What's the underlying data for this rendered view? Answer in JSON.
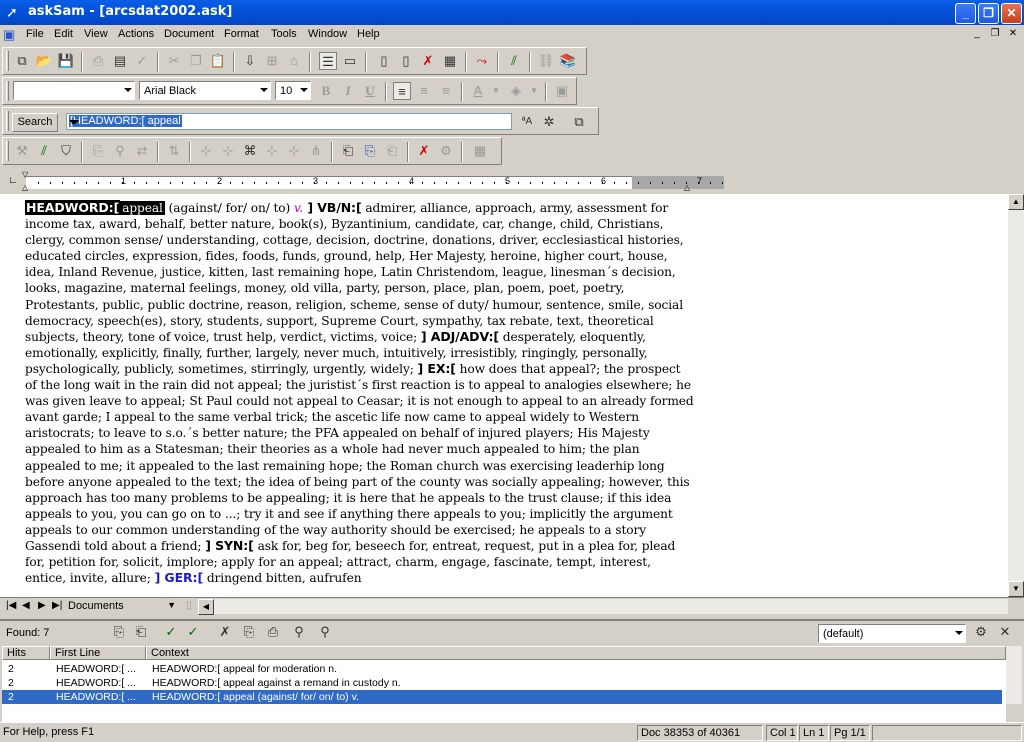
{
  "window": {
    "title": "askSam - [arcsdat2002.ask]",
    "minimize": "_",
    "restore": "❐",
    "close": "✕"
  },
  "menu": {
    "items": [
      "File",
      "Edit",
      "View",
      "Actions",
      "Document",
      "Format",
      "Tools",
      "Window",
      "Help"
    ],
    "mdi_min": "_",
    "mdi_restore": "❐",
    "mdi_close": "✕"
  },
  "format_bar": {
    "style_value": "",
    "font_value": "Arial Black",
    "size_value": "10",
    "bold": "B",
    "italic": "I",
    "underline": "U"
  },
  "search_bar": {
    "button_label": "Search",
    "query": "[HEADWORD:[ appeal"
  },
  "ruler": {
    "marks": [
      "1",
      "2",
      "3",
      "4",
      "5",
      "6",
      "7"
    ]
  },
  "document": {
    "headword_tag": "HEADWORD:[",
    "headword": "appeal",
    "senses": " (against/ for/ on/ to) ",
    "pos": "v.",
    "vbn_tag": " ] VB/N:[",
    "vbn_text": " admirer, alliance, approach, army, assessment for income tax, award, behalf, better nature, book(s), Byzantinium, candidate, car, change, child, Christians, clergy, common sense/ understanding, cottage, decision, doctrine, donations, driver, ecclesiastical histories, educated circles, expression, fides, foods, funds, ground, help, Her Majesty, heroine, higher court, house, idea, Inland Revenue, justice, kitten, last remaining hope, Latin Christendom, league, linesman´s decision, looks, magazine, maternal feelings, money, old villa, party, person, place, plan, poem, poet, poetry, Protestants, public, public doctrine, reason, religion, scheme, sense of duty/ humour, sentence, smile, social democracy, speech(es), story, students, support, Supreme Court, sympathy, tax rebate, text, theoretical subjects, theory, tone of voice, trust help, verdict, victims, voice;  ",
    "adjadv_tag": "] ADJ/ADV:[",
    "adjadv_text": " desperately, eloquently, emotionally, explicitly, finally, further, largely, never much, intuitively, irresistibly, ringingly, personally, psychologically, publicly, sometimes, stirringly, urgently, widely;  ",
    "ex_tag": "] EX:[",
    "ex_text": " how does that appeal?; the prospect of the long wait in the rain did not appeal; the juristist´s first reaction is to appeal to analogies elsewhere; he was given leave to appeal; St Paul could not appeal to Ceasar; it is not enough to appeal to an already formed avant garde; I appeal to the same verbal trick; the ascetic life now came to appeal widely to Western aristocrats; to leave to s.o.´s better nature; the PFA appealed on behalf of injured players; His Majesty appealed to him as a Statesman; their theories as a whole had never much appealed to him; the plan appealed to me; it appealed to the last remaining hope; the Roman church was exercising leaderhip long before anyone appealed to the text; the idea of being part of the county was socially appealing; however, this approach has too many problems to be appealing; it is here that he appeals to the trust clause; if this idea appeals to you, you can go on to ...; try it and see if anything there appeals to you; implicitly the argument appeals to our common understanding of the way authority should be exercised; he appeals to a story Gassendi told about a friend;  ",
    "syn_tag": "] SYN:[",
    "syn_text": " ask for, beg for, beseech for, entreat, request, put in a plea for, plead for, petition for, solicit, implore; apply for an appeal; attract, charm, engage, fascinate, tempt, interest, entice, invite, allure;  ",
    "ger_tag": "] GER:[",
    "ger_text": " dringend bitten, aufrufen"
  },
  "hscroll": {
    "documents_label": "Documents"
  },
  "results": {
    "found_label": "Found: 7",
    "view_value": "(default)",
    "columns": [
      "Hits",
      "First Line",
      "Context"
    ],
    "rows": [
      {
        "hits": "2",
        "first_line": "HEADWORD:[ ...",
        "context": "HEADWORD:[ appeal for moderation  n."
      },
      {
        "hits": "2",
        "first_line": "HEADWORD:[ ...",
        "context": "HEADWORD:[ appeal against a remand in custody  n."
      },
      {
        "hits": "2",
        "first_line": "HEADWORD:[ ...",
        "context": "HEADWORD:[ appeal (against/ for/ on/ to) v."
      }
    ]
  },
  "status": {
    "help": "For Help, press F1",
    "doc": "Doc 38353 of 40361",
    "col": "Col 1",
    "ln": "Ln 1",
    "pg": "Pg 1/1"
  },
  "colors": {
    "titlebar": "#0553d9",
    "selection": "#316ac5",
    "pos_italic": "#c000c0",
    "ger_tag": "#1a1acc"
  }
}
